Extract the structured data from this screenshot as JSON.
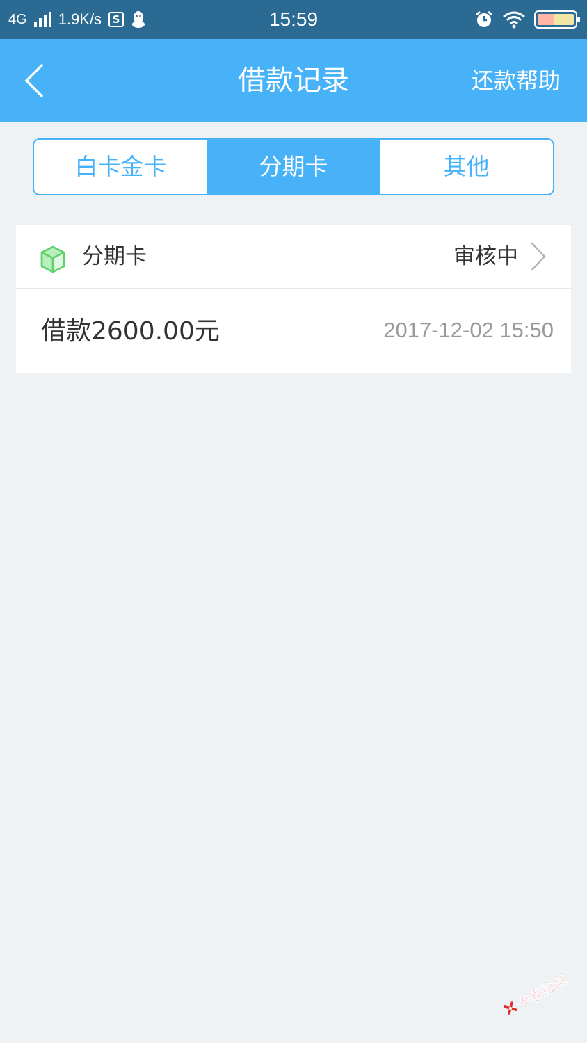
{
  "status_bar": {
    "network": "4G",
    "speed": "1.9K/s",
    "s_badge": "S",
    "time": "15:59",
    "icons": [
      "signal-icon",
      "s-app-icon",
      "qq-icon",
      "alarm-icon",
      "wifi-icon",
      "battery-icon"
    ]
  },
  "nav": {
    "title": "借款记录",
    "help_label": "还款帮助",
    "back_icon": "chevron-left-icon"
  },
  "tabs": [
    {
      "label": "白卡金卡",
      "active": false
    },
    {
      "label": "分期卡",
      "active": true
    },
    {
      "label": "其他",
      "active": false
    }
  ],
  "record": {
    "type_icon": "cube-icon",
    "type_label": "分期卡",
    "status": "审核中",
    "amount": "借款2600.00元",
    "time": "2017-12-02 15:50"
  },
  "watermark": {
    "text": "卡农社区"
  },
  "colors": {
    "status_bar_bg": "#2b6b93",
    "accent": "#47b2f7",
    "page_bg": "#eff2f5",
    "cube_green": "#5fd16a",
    "watermark_red": "#e0302a"
  }
}
